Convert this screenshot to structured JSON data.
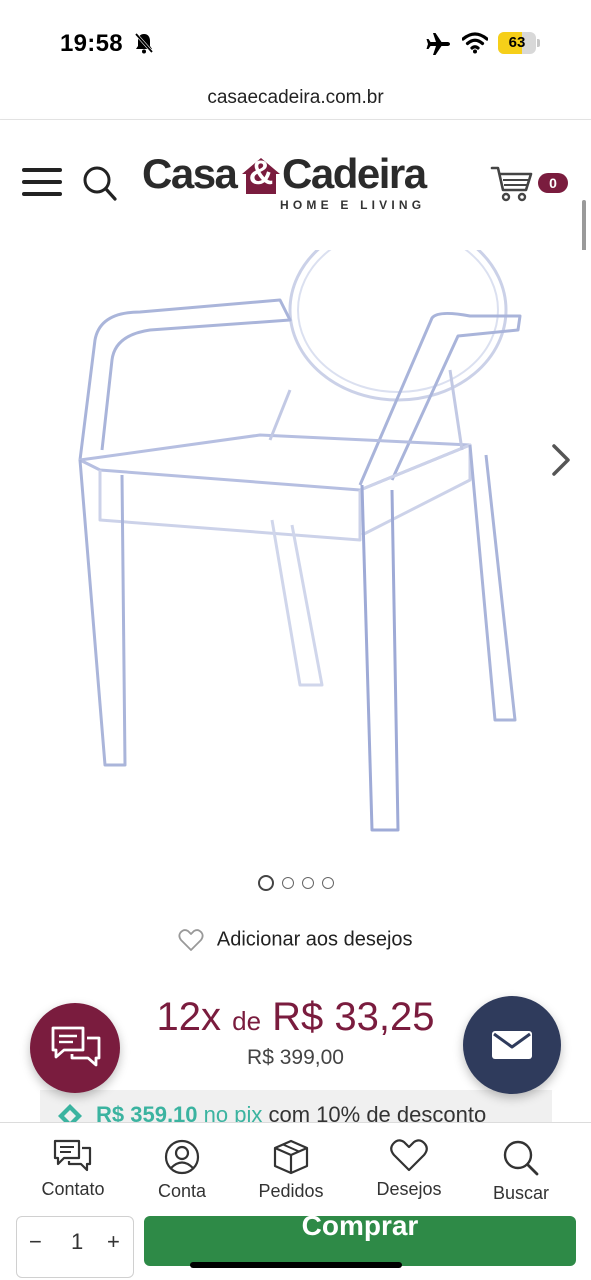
{
  "status_bar": {
    "time": "19:58",
    "battery": "63",
    "battery_level": 0.63
  },
  "browser": {
    "url": "casaecadeira.com.br"
  },
  "header": {
    "logo_left": "Casa",
    "logo_amp": "&",
    "logo_right": "Cadeira",
    "logo_tagline": "HOME E LIVING",
    "cart_count": "0"
  },
  "gallery": {
    "total_images": 4,
    "active_index": 0
  },
  "product": {
    "wishlist_label": "Adicionar aos desejos",
    "installment_count": "12x",
    "installment_de": "de",
    "installment_value": "R$ 33,25",
    "price": "R$ 399,00",
    "pix_price": "R$ 359,10",
    "pix_link": "no pix",
    "pix_discount": "com 10% de desconto"
  },
  "bottom_nav": [
    {
      "label": "Contato",
      "icon": "chat-icon"
    },
    {
      "label": "Conta",
      "icon": "user-icon"
    },
    {
      "label": "Pedidos",
      "icon": "box-icon"
    },
    {
      "label": "Desejos",
      "icon": "heart-icon"
    },
    {
      "label": "Buscar",
      "icon": "search-icon"
    }
  ],
  "buy_bar": {
    "qty_minus": "−",
    "qty_value": "1",
    "qty_plus": "+",
    "buy_label": "Comprar"
  },
  "colors": {
    "brand": "#7a1c3e",
    "pix": "#3bb3a0",
    "buy": "#2e8a47",
    "mail_fab": "#2f3b5c"
  }
}
